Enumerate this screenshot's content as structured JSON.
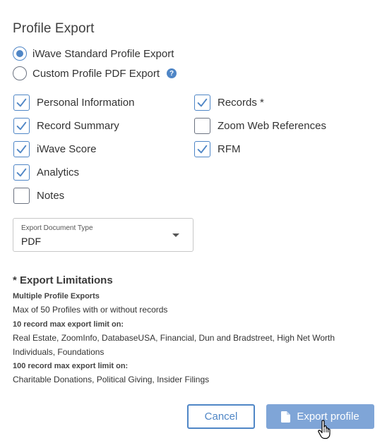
{
  "dialog": {
    "title": "Profile Export",
    "radios": [
      {
        "label": "iWave Standard Profile Export",
        "checked": true
      },
      {
        "label": "Custom Profile PDF Export",
        "checked": false
      }
    ],
    "help_icon": "?",
    "checkboxes_left": [
      {
        "label": "Personal Information",
        "checked": true
      },
      {
        "label": "Record Summary",
        "checked": true
      },
      {
        "label": "iWave Score",
        "checked": true
      },
      {
        "label": "Analytics",
        "checked": true
      },
      {
        "label": "Notes",
        "checked": false
      }
    ],
    "checkboxes_right": [
      {
        "label": "Records *",
        "checked": true
      },
      {
        "label": "Zoom Web References",
        "checked": false
      },
      {
        "label": "RFM",
        "checked": true
      }
    ],
    "select": {
      "label": "Export Document Type",
      "value": "PDF"
    },
    "limitations": {
      "title": "* Export Limitations",
      "sections": [
        {
          "heading": "Multiple Profile Exports",
          "text": "Max of 50 Profiles with or without records"
        },
        {
          "heading": "10 record max export limit on:",
          "text": "Real Estate, ZoomInfo, DatabaseUSA, Financial, Dun and Bradstreet, High Net Worth Individuals, Foundations"
        },
        {
          "heading": "100 record max export limit on:",
          "text": "Charitable Donations, Political Giving, Insider Filings"
        }
      ]
    },
    "buttons": {
      "cancel": "Cancel",
      "export": "Export profile"
    },
    "colors": {
      "accent": "#4f86c6",
      "export_button_bg": "#7fa5d7"
    }
  }
}
